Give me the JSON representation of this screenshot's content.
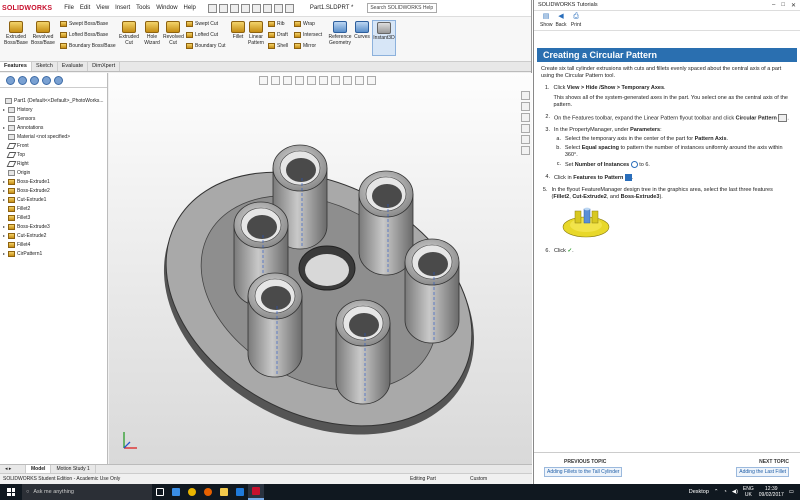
{
  "app": {
    "logo": "SOLIDWORKS",
    "menu": [
      "File",
      "Edit",
      "View",
      "Insert",
      "Tools",
      "Window",
      "Help"
    ],
    "filename": "Part1.SLDPRT *",
    "search_placeholder": "Search SOLIDWORKS Help"
  },
  "commands": {
    "extruded_boss": "Extruded Boss/Base",
    "revolved_boss": "Revolved Boss/Base",
    "swept_boss": "Swept Boss/Base",
    "lofted_boss": "Lofted Boss/Base",
    "boundary_boss": "Boundary Boss/Base",
    "extruded_cut": "Extruded Cut",
    "hole_wizard": "Hole Wizard",
    "revolved_cut": "Revolved Cut",
    "swept_cut": "Swept Cut",
    "lofted_cut": "Lofted Cut",
    "boundary_cut": "Boundary Cut",
    "fillet": "Fillet",
    "linear_pattern": "Linear Pattern",
    "rib": "Rib",
    "draft": "Draft",
    "shell": "Shell",
    "wrap": "Wrap",
    "intersect": "Intersect",
    "mirror": "Mirror",
    "reference_geometry": "Reference Geometry",
    "curves": "Curves",
    "instant3d": "Instant3D"
  },
  "tabs": [
    "Features",
    "Sketch",
    "Evaluate",
    "DimXpert"
  ],
  "tree": [
    {
      "label": "Part1  (Default<<Default>_PhotoWorks...",
      "kind": "root",
      "arrow": ""
    },
    {
      "label": "History",
      "kind": "item",
      "arrow": "▸"
    },
    {
      "label": "Sensors",
      "kind": "item",
      "arrow": ""
    },
    {
      "label": "Annotations",
      "kind": "item",
      "arrow": "▸"
    },
    {
      "label": "Material <not specified>",
      "kind": "item",
      "arrow": ""
    },
    {
      "label": "Front",
      "kind": "plane",
      "arrow": ""
    },
    {
      "label": "Top",
      "kind": "plane",
      "arrow": ""
    },
    {
      "label": "Right",
      "kind": "plane",
      "arrow": ""
    },
    {
      "label": "Origin",
      "kind": "item",
      "arrow": ""
    },
    {
      "label": "Boss-Extrude1",
      "kind": "feat",
      "arrow": "▸"
    },
    {
      "label": "Boss-Extrude2",
      "kind": "feat",
      "arrow": "▸"
    },
    {
      "label": "Cut-Extrude1",
      "kind": "feat",
      "arrow": "▸"
    },
    {
      "label": "Fillet2",
      "kind": "feat",
      "arrow": ""
    },
    {
      "label": "Fillet3",
      "kind": "feat",
      "arrow": ""
    },
    {
      "label": "Boss-Extrude3",
      "kind": "feat",
      "arrow": "▸"
    },
    {
      "label": "Cut-Extrude2",
      "kind": "feat",
      "arrow": "▸"
    },
    {
      "label": "Fillet4",
      "kind": "feat",
      "arrow": ""
    },
    {
      "label": "CirPattern1",
      "kind": "feat",
      "arrow": "▸"
    }
  ],
  "bottom_tabs": [
    "Model",
    "Motion Study 1"
  ],
  "status": {
    "edition": "SOLIDWORKS Student Edition - Academic Use Only",
    "mode": "Editing Part",
    "units": "Custom"
  },
  "help": {
    "window_title": "SOLIDWORKS Tutorials",
    "toolbar": [
      "Show",
      "Back",
      "Print"
    ],
    "banner": "Creating a Circular Pattern",
    "intro": "Create six tall cylinder extrusions with cuts and fillets evenly spaced about the central axis of a part using the Circular Pattern tool.",
    "step1_num": "1.",
    "step1_a": "Click ",
    "step1_b": "View > Hide /Show > Temporary Axes",
    "step1_c": ".",
    "step1_note": "This shows all of the system-generated axes in the part. You select one as the central axis of the pattern.",
    "step2_num": "2.",
    "step2_a": "On the Features toolbar, expand the Linear Pattern flyout toolbar and click ",
    "step2_b": "Circular Pattern",
    "step3_num": "3.",
    "step3_a": "In the PropertyManager, under ",
    "step3_b": "Parameters",
    "step3_c": ":",
    "sub_a_num": "a.",
    "sub_a_1": "Select the temporary axis in the center of the part for ",
    "sub_a_2": "Pattern Axis",
    "sub_a_3": ".",
    "sub_b_num": "b.",
    "sub_b_1": "Select ",
    "sub_b_2": "Equal spacing",
    "sub_b_3": " to pattern the number of instances uniformly around the axis within 360°.",
    "sub_c_num": "c.",
    "sub_c_1": "Set ",
    "sub_c_2": "Number of Instances",
    "sub_c_3": " to 6.",
    "step4_num": "4.",
    "step4_a": "Click in ",
    "step4_b": "Features to Pattern",
    "step4_c": ".",
    "step5_num": "5.",
    "step5_a": "In the flyout FeatureManager design tree in the graphics area, select the last three features (",
    "step5_b": "Fillet2",
    "step5_c": ", ",
    "step5_d": "Cut-Extrude2",
    "step5_e": ", and ",
    "step5_f": "Boss-Extrude3",
    "step5_g": ").",
    "step6_num": "6.",
    "step6_a": "Click ",
    "step6_check": "✓",
    "step6_b": ".",
    "prev_label": "PREVIOUS TOPIC",
    "prev_link": "Adding Fillets to the Tall Cylinder",
    "next_label": "NEXT TOPIC",
    "next_link": "Adding the Last Fillet"
  },
  "taskbar": {
    "search": "Ask me anything",
    "desktop": "Desktop",
    "lang_1": "ENG",
    "lang_2": "UK",
    "time": "12:39",
    "date": "09/02/2017"
  },
  "colors": {
    "banner": "#2a6fb0",
    "solidworks_red": "#c8102e",
    "taskbar": "#101820"
  }
}
